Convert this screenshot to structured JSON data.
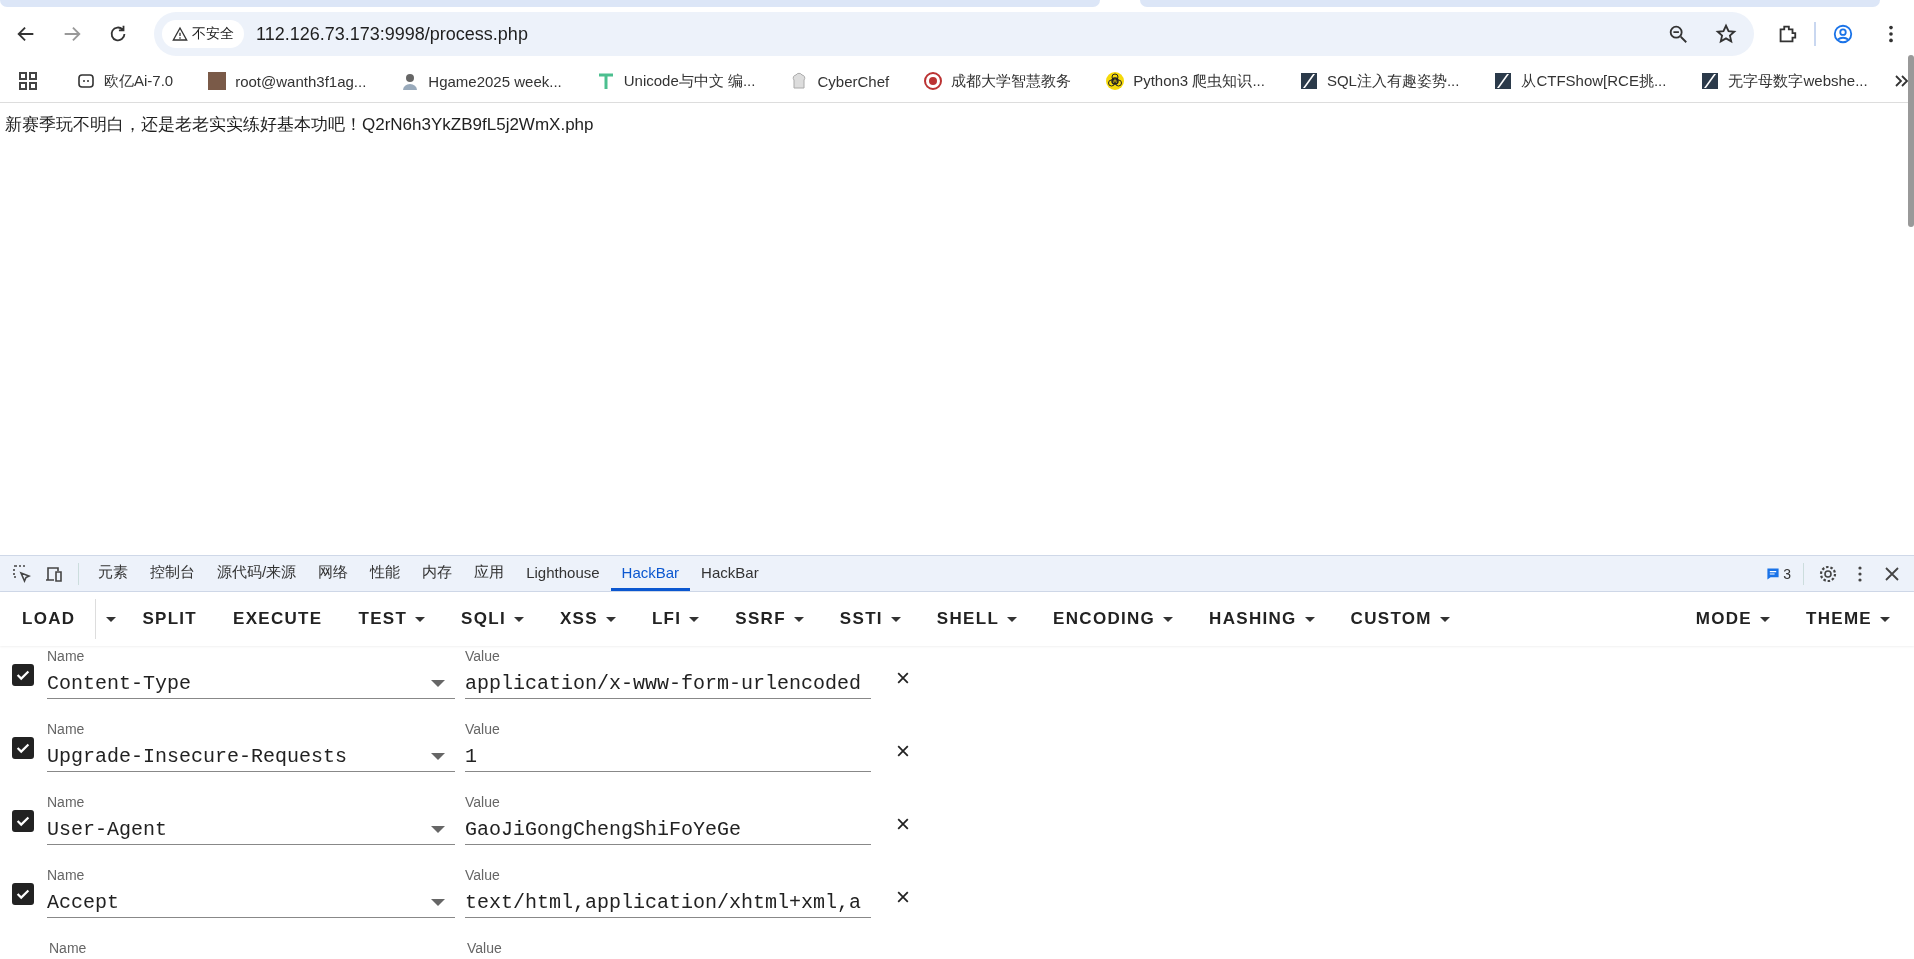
{
  "browser": {
    "security_label": "不安全",
    "url": "112.126.73.173:9998/process.php"
  },
  "bookmarks": [
    {
      "kind": "chat",
      "label": "欧亿Ai-7.0"
    },
    {
      "kind": "photo",
      "label": "root@wanth3f1ag..."
    },
    {
      "kind": "avatar",
      "label": "Hgame2025 week..."
    },
    {
      "kind": "tee",
      "label": "Unicode与中文 编..."
    },
    {
      "kind": "chef",
      "label": "CyberChef"
    },
    {
      "kind": "seal",
      "label": "成都大学智慧教务"
    },
    {
      "kind": "hazard",
      "label": "Python3 爬虫知识..."
    },
    {
      "kind": "slash",
      "label": "SQL注入有趣姿势..."
    },
    {
      "kind": "slash",
      "label": "从CTFShow[RCE挑..."
    },
    {
      "kind": "slash",
      "label": "无字母数字webshe..."
    }
  ],
  "page_text": "新赛季玩不明白，还是老老实实练好基本功吧！Q2rN6h3YkZB9fL5j2WmX.php",
  "devtools": {
    "tabs": [
      {
        "label": "元素",
        "selected": false
      },
      {
        "label": "控制台",
        "selected": false
      },
      {
        "label": "源代码/来源",
        "selected": false
      },
      {
        "label": "网络",
        "selected": false
      },
      {
        "label": "性能",
        "selected": false
      },
      {
        "label": "内存",
        "selected": false
      },
      {
        "label": "应用",
        "selected": false
      },
      {
        "label": "Lighthouse",
        "selected": false
      },
      {
        "label": "HackBar",
        "selected": true
      },
      {
        "label": "HackBar",
        "selected": false
      }
    ],
    "issues_count": "3"
  },
  "hackbar": {
    "menus": [
      {
        "label": "LOAD",
        "dropdown": false,
        "split": true
      },
      {
        "label": "SPLIT",
        "dropdown": false,
        "split": false
      },
      {
        "label": "EXECUTE",
        "dropdown": false,
        "split": false
      },
      {
        "label": "TEST",
        "dropdown": true,
        "split": false
      },
      {
        "label": "SQLI",
        "dropdown": true,
        "split": false
      },
      {
        "label": "XSS",
        "dropdown": true,
        "split": false
      },
      {
        "label": "LFI",
        "dropdown": true,
        "split": false
      },
      {
        "label": "SSRF",
        "dropdown": true,
        "split": false
      },
      {
        "label": "SSTI",
        "dropdown": true,
        "split": false
      },
      {
        "label": "SHELL",
        "dropdown": true,
        "split": false
      },
      {
        "label": "ENCODING",
        "dropdown": true,
        "split": false
      },
      {
        "label": "HASHING",
        "dropdown": true,
        "split": false
      },
      {
        "label": "CUSTOM",
        "dropdown": true,
        "split": false
      }
    ],
    "right_menus": [
      {
        "label": "MODE",
        "dropdown": true
      },
      {
        "label": "THEME",
        "dropdown": true
      }
    ],
    "headers": [
      {
        "checked": true,
        "name_label": "Name",
        "name": "Content-Type",
        "value_label": "Value",
        "value": "application/x-www-form-urlencoded"
      },
      {
        "checked": true,
        "name_label": "Name",
        "name": "Upgrade-Insecure-Requests",
        "value_label": "Value",
        "value": "1"
      },
      {
        "checked": true,
        "name_label": "Name",
        "name": "User-Agent",
        "value_label": "Value",
        "value": "GaoJiGongChengShiFoYeGe"
      },
      {
        "checked": true,
        "name_label": "Name",
        "name": "Accept",
        "value_label": "Value",
        "value": "text/html,application/xhtml+xml,a"
      }
    ],
    "cut_row": {
      "name_label": "Name",
      "value_label": "Value"
    }
  }
}
